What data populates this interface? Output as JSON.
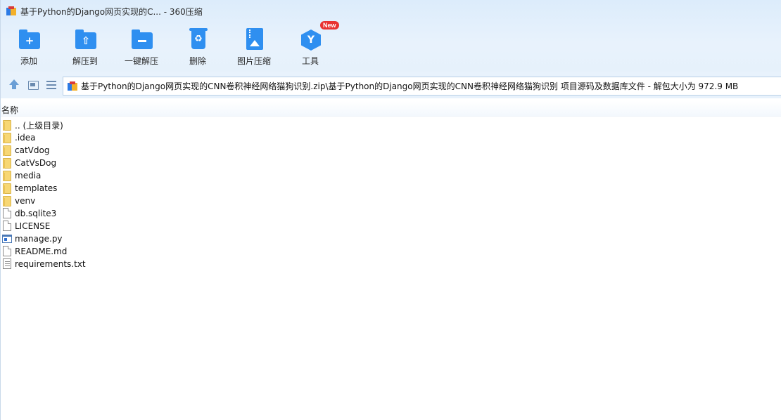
{
  "window": {
    "title": "基于Python的Django网页实现的C... - 360压缩"
  },
  "toolbar": {
    "items": [
      {
        "label": "添加",
        "icon": "add-folder-icon"
      },
      {
        "label": "解压到",
        "icon": "extract-to-icon"
      },
      {
        "label": "一键解压",
        "icon": "one-click-extract-icon"
      },
      {
        "label": "删除",
        "icon": "trash-icon"
      },
      {
        "label": "图片压缩",
        "icon": "image-compress-icon"
      },
      {
        "label": "工具",
        "icon": "tools-icon",
        "badge": "New"
      }
    ]
  },
  "address": {
    "path": "基于Python的Django网页实现的CNN卷积神经网络猫狗识别.zip\\基于Python的Django网页实现的CNN卷积神经网络猫狗识别 项目源码及数据库文件 - 解包大小为 972.9 MB"
  },
  "list": {
    "column_name": "名称",
    "items": [
      {
        "name": ".. (上级目录)",
        "type": "folder"
      },
      {
        "name": ".idea",
        "type": "folder"
      },
      {
        "name": "catVdog",
        "type": "folder"
      },
      {
        "name": "CatVsDog",
        "type": "folder"
      },
      {
        "name": "media",
        "type": "folder"
      },
      {
        "name": "templates",
        "type": "folder"
      },
      {
        "name": "venv",
        "type": "folder"
      },
      {
        "name": "db.sqlite3",
        "type": "file"
      },
      {
        "name": "LICENSE",
        "type": "file"
      },
      {
        "name": "manage.py",
        "type": "python"
      },
      {
        "name": "README.md",
        "type": "file"
      },
      {
        "name": "requirements.txt",
        "type": "text"
      }
    ]
  },
  "colors": {
    "accent": "#2f8ff0",
    "badge": "#e83232",
    "folder": "#f7d774"
  }
}
